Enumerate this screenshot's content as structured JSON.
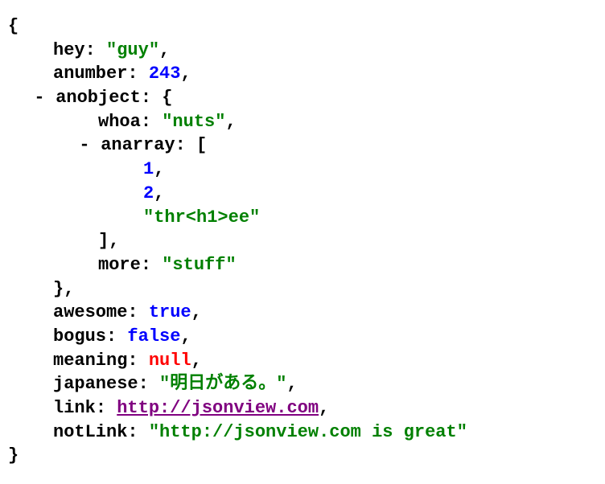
{
  "syntax": {
    "open_brace": "{",
    "close_brace": "}",
    "open_bracket": "[",
    "close_bracket": "]",
    "comma": ",",
    "colon": ":",
    "toggle_collapse": "-",
    "quote": "\""
  },
  "root": {
    "hey": {
      "key": "hey",
      "value": "guy"
    },
    "anumber": {
      "key": "anumber",
      "value": "243"
    },
    "anobject": {
      "key": "anobject",
      "whoa": {
        "key": "whoa",
        "value": "nuts"
      },
      "anarray": {
        "key": "anarray",
        "items": {
          "0": "1",
          "1": "2",
          "2": "thr<h1>ee"
        }
      },
      "more": {
        "key": "more",
        "value": "stuff"
      }
    },
    "awesome": {
      "key": "awesome",
      "value": "true"
    },
    "bogus": {
      "key": "bogus",
      "value": "false"
    },
    "meaning": {
      "key": "meaning",
      "value": "null"
    },
    "japanese": {
      "key": "japanese",
      "value": "明日がある。"
    },
    "link": {
      "key": "link",
      "value": "http://jsonview.com"
    },
    "notLink": {
      "key": "notLink",
      "value": "http://jsonview.com is great"
    }
  }
}
